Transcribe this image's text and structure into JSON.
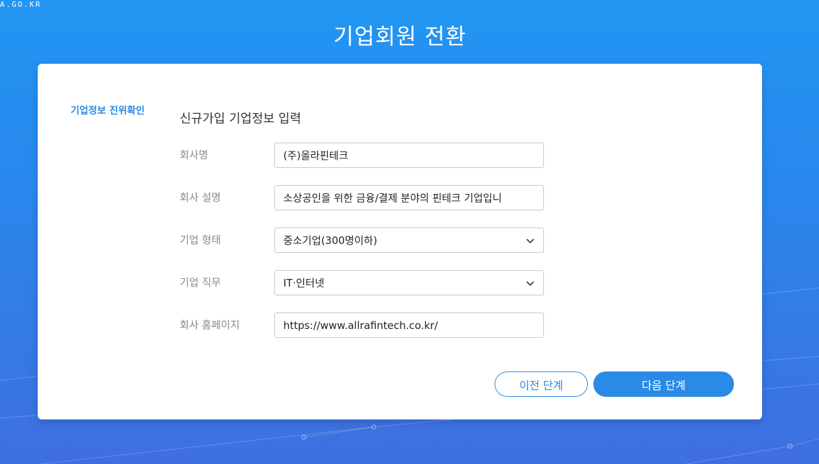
{
  "header": {
    "site_url": "A.GO.KR",
    "title": "기업회원 전환"
  },
  "sidebar": {
    "current_step": "기업정보 진위확인"
  },
  "form": {
    "section_title": "신규가입 기업정보 입력",
    "company_name": {
      "label": "회사명",
      "value": "(주)올라핀테크"
    },
    "company_description": {
      "label": "회사 설명",
      "value": "소상공인을 위한 금융/결제 분야의 핀테크 기업입니"
    },
    "company_type": {
      "label": "기업 형태",
      "selected": "중소기업(300명이하)"
    },
    "company_industry": {
      "label": "기업 직무",
      "selected": "IT·인터넷"
    },
    "company_homepage": {
      "label": "회사 홈페이지",
      "value": "https://www.allrafintech.co.kr/"
    }
  },
  "buttons": {
    "prev": "이전 단계",
    "next": "다음 단계"
  },
  "colors": {
    "background_top": "#2196f3",
    "background_bottom": "#3f6fe0",
    "accent": "#2a8ae6"
  },
  "icons": {
    "dropdown": "chevron-down-icon"
  }
}
